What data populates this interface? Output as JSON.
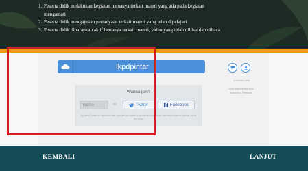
{
  "steps": [
    {
      "num": "1.",
      "text": "Peserta didik melakukan kegiatan menanya terkait materi yang ada pada kegiatan"
    },
    {
      "num": "",
      "text": "mengamati"
    },
    {
      "num": "2.",
      "text": "Peserta didik mengajukan pertanyaan terkait materi yang telah dipelajari"
    },
    {
      "num": "3.",
      "text": "Peserta didik diharapkan aktif bertanya terkait materi, video yang telah dilihat dan dibaca"
    }
  ],
  "brand": {
    "label": "lkpdpintar",
    "icon": "cloud-icon"
  },
  "side": {
    "icons": [
      "chat-icon",
      "user-icon"
    ],
    "line1": "A chat by olark",
    "line2": "Help improve this chat:",
    "line3": "become a Premium"
  },
  "share": {
    "title": "Wanna join?",
    "name_placeholder": "Name",
    "separator": "or",
    "twitter_label": "Twitter",
    "facebook_label": "Facebook",
    "fine_print": "By using Twitter or Facebook with your site you agree to our terms and service. We won't share or post as you in the blog."
  },
  "footer": {
    "back_label": "KEMBALI",
    "next_label": "LANJUT"
  },
  "colors": {
    "banner": "#1e2a24",
    "accent_orange": "#f39c12",
    "brand_blue": "#4a8fd8",
    "footer_teal": "#164c57",
    "highlight_red": "#d21f1f"
  }
}
